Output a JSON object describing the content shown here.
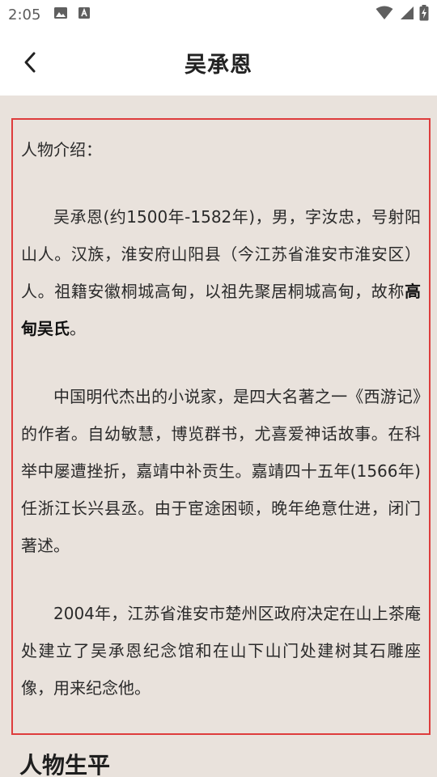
{
  "status_bar": {
    "time": "2:05",
    "icons": [
      "image-icon",
      "font-download-icon"
    ],
    "right_icons": [
      "wifi-icon",
      "signal-icon",
      "battery-charging-icon"
    ]
  },
  "header": {
    "back_icon": "back-arrow-icon",
    "title": "吴承恩"
  },
  "content": {
    "intro_heading": "人物介绍：",
    "para1_before": "吴承恩(约1500年-1582年)，男，字汝忠，号射阳山人。汉族，淮安府山阳县（今江苏省淮安市淮安区）人。祖籍安徽桐城高甸，以祖先聚居桐城高甸，故称",
    "para1_bold": "高甸吴氏",
    "para1_after": "。",
    "para2": "中国明代杰出的小说家，是四大名著之一《西游记》的作者。自幼敏慧，博览群书，尤喜爱神话故事。在科举中屡遭挫折，嘉靖中补贡生。嘉靖四十五年(1566年)任浙江长兴县丞。由于宦途困顿，晚年绝意仕进，闭门著述。",
    "para3": "2004年，江苏省淮安市楚州区政府决定在山上茶庵处建立了吴承恩纪念馆和在山下山门处建树其石雕座像，用来纪念他。"
  },
  "section": {
    "heading": "人物生平"
  },
  "colors": {
    "background": "#e9e2dc",
    "highlight_border": "#de3c3c",
    "header_bg": "#ffffff"
  }
}
